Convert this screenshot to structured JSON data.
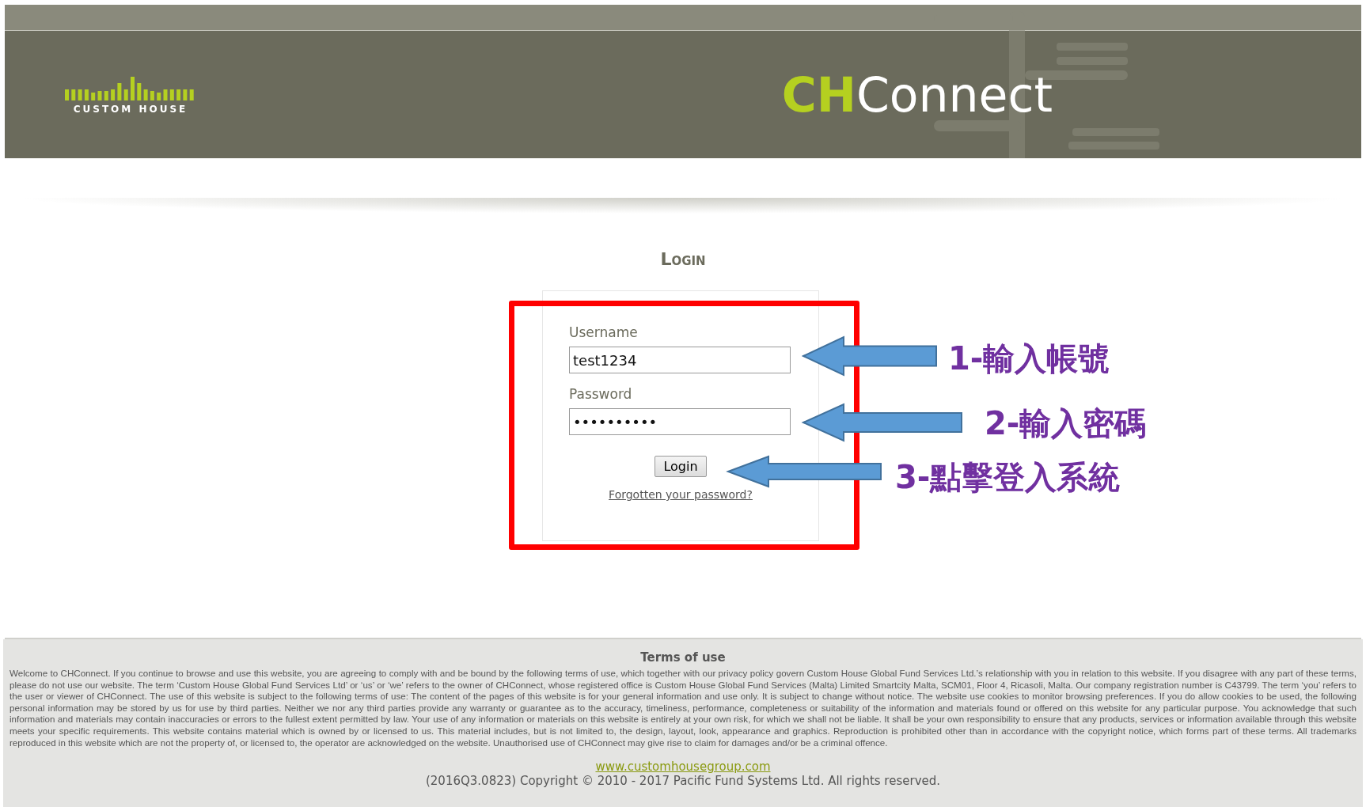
{
  "header": {
    "logo_text": "CUSTOM HOUSE",
    "brand": {
      "prefix": "CH",
      "name": "Connect"
    }
  },
  "login": {
    "title": "Login",
    "username": {
      "label": "Username",
      "value": "test1234"
    },
    "password": {
      "label": "Password",
      "value": "••••••••••"
    },
    "button": "Login",
    "forgot_link": "Forgotten your password?"
  },
  "annotations": [
    "1-輸入帳號",
    "2-輸入密碼",
    "3-點擊登入系統"
  ],
  "footer": {
    "terms_title": "Terms of use",
    "terms_text": "Welcome to CHConnect. If you continue to browse and use this website, you are agreeing to comply with and be bound by the following terms of use, which together with our privacy policy govern Custom House Global Fund Services Ltd.’s relationship with you in relation to this website. If you disagree with any part of these terms, please do not use our website. The term ‘Custom House Global Fund Services Ltd’ or ‘us’ or ‘we’ refers to the owner of CHConnect, whose registered office is Custom House Global Fund Services (Malta) Limited Smartcity Malta, SCM01, Floor 4, Ricasoli, Malta. Our company registration number is C43799. The term ‘you’ refers to the user or viewer of CHConnect. The use of this website is subject to the following terms of use: The content of the pages of this website is for your general information and use only. It is subject to change without notice. The website use cookies to monitor browsing preferences. If you do allow cookies to be used, the following personal information may be stored by us for use by third parties. Neither we nor any third parties provide any warranty or guarantee as to the accuracy, timeliness, performance, completeness or suitability of the information and materials found or offered on this website for any particular purpose. You acknowledge that such information and materials may contain inaccuracies or errors to the fullest extent permitted by law. Your use of any information or materials on this website is entirely at your own risk, for which we shall not be liable. It shall be your own responsibility to ensure that any products, services or information available through this website meets your specific requirements. This website contains material which is owned by or licensed to us. This material includes, but is not limited to, the design, layout, look, appearance and graphics. Reproduction is prohibited other than in accordance with the copyright notice, which forms part of these terms. All trademarks reproduced in this website which are not the property of, or licensed to, the operator are acknowledged on the website. Unauthorised use of CHConnect may give rise to claim for damages and/or be a criminal offence.",
    "link": "www.customhousegroup.com",
    "copyright": "(2016Q3.0823) Copyright © 2010 - 2017 Pacific Fund Systems Ltd. All rights reserved."
  }
}
